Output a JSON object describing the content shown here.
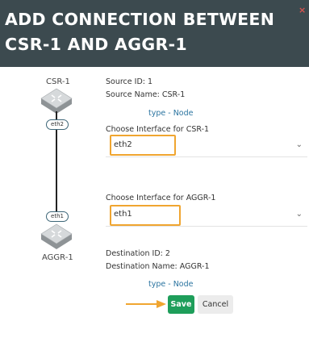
{
  "dialog": {
    "title_line1": "ADD CONNECTION BETWEEN",
    "title_line2": "CSR-1 AND AGGR-1",
    "close_glyph": "×"
  },
  "diagram": {
    "source_label": "CSR-1",
    "dest_label": "AGGR-1",
    "source_port": "eth2",
    "dest_port": "eth1"
  },
  "source": {
    "id_text": "Source ID: 1",
    "name_text": "Source Name: CSR-1",
    "type_text": "type - Node",
    "interface_label": "Choose Interface for CSR-1",
    "interface_value": "eth2"
  },
  "destination": {
    "interface_label": "Choose Interface for AGGR-1",
    "interface_value": "eth1",
    "id_text": "Destination ID: 2",
    "name_text": "Destination Name: AGGR-1",
    "type_text": "type - Node"
  },
  "actions": {
    "save_label": "Save",
    "cancel_label": "Cancel"
  },
  "colors": {
    "header_bg": "#3c4a4f",
    "highlight": "#f0a530",
    "save_bg": "#1e9e5a",
    "link_type": "#2b74a0"
  },
  "icons": [
    "router-icon",
    "chevron-down-icon",
    "close-icon",
    "arrow-right-icon"
  ]
}
